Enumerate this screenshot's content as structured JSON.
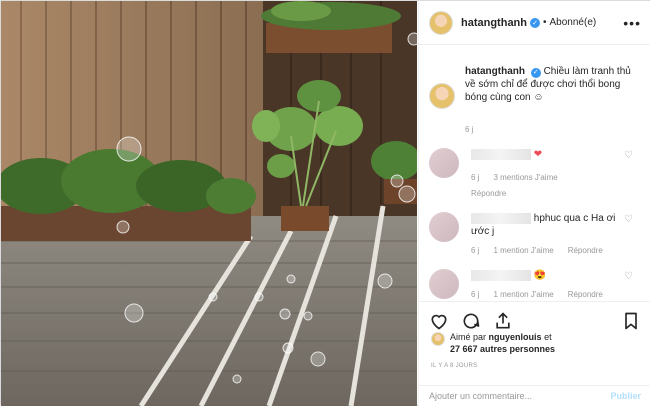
{
  "header": {
    "username": "hatangthanh",
    "dot": "•",
    "follow_status": "Abonné(e)",
    "more": "•••"
  },
  "caption": {
    "username": "hatangthanh",
    "text": "Chiều làm tranh thủ về sớm chỉ để được chơi thổi bong bóng cùng con ☺",
    "age": "6 j"
  },
  "comments": [
    {
      "suffix": "❤",
      "age": "6 j",
      "likes": "3 mentions J'aime",
      "reply": "Répondre"
    },
    {
      "suffix": "hphuc qua c Ha ơi ước j",
      "age": "6 j",
      "likes": "1 mention J'aime",
      "reply": "Répondre"
    },
    {
      "suffix": "😍",
      "age": "6 j",
      "likes": "1 mention J'aime",
      "reply": "Répondre"
    }
  ],
  "likes": {
    "prefix": "Aimé par",
    "user": "nguyenlouis",
    "connector": "et",
    "others": "27 667 autres personnes"
  },
  "timestamp": "IL Y A 8 JOURS",
  "add_comment": {
    "placeholder": "Ajouter un commentaire...",
    "publish": "Publier"
  },
  "colors": {
    "link": "#3897f0",
    "heart": "#ed4956",
    "publish_disabled": "#b2dffc"
  }
}
